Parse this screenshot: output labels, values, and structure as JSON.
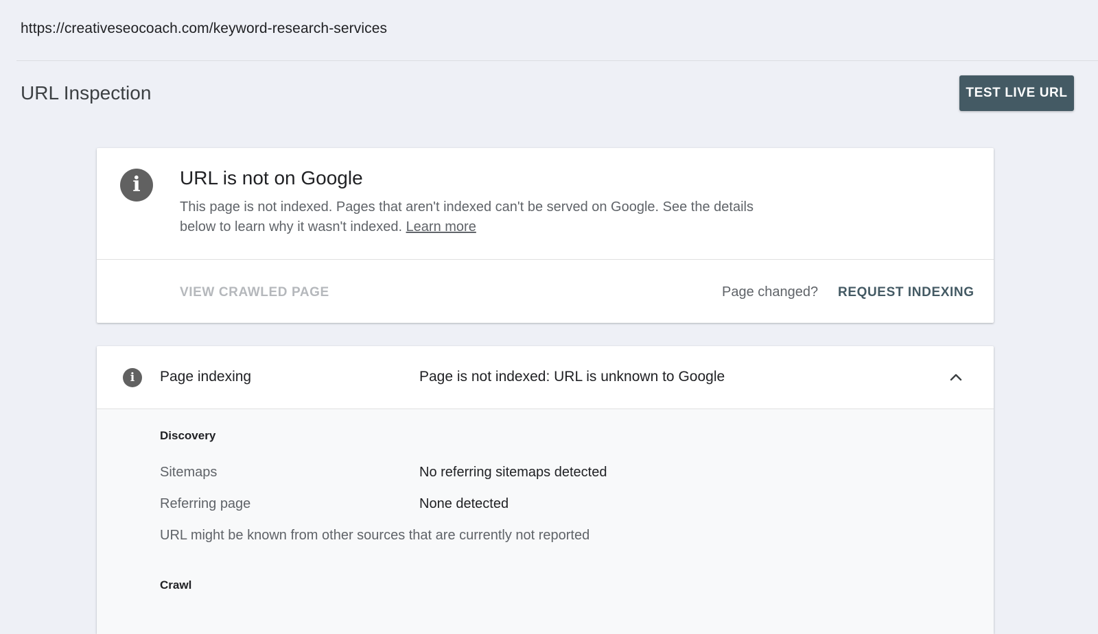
{
  "url_bar": {
    "url": "https://creativeseocoach.com/keyword-research-services"
  },
  "header": {
    "title": "URL Inspection",
    "test_live_url_label": "TEST LIVE URL"
  },
  "status_card": {
    "title": "URL is not on Google",
    "description": "This page is not indexed. Pages that aren't indexed can't be served on Google. See the details below to learn why it wasn't indexed.",
    "learn_more_label": "Learn more",
    "view_crawled_label": "VIEW CRAWLED PAGE",
    "page_changed_label": "Page changed?",
    "request_indexing_label": "REQUEST INDEXING"
  },
  "indexing_card": {
    "label": "Page indexing",
    "status": "Page is not indexed: URL is unknown to Google",
    "discovery": {
      "heading": "Discovery",
      "rows": [
        {
          "label": "Sitemaps",
          "value": "No referring sitemaps detected"
        },
        {
          "label": "Referring page",
          "value": "None detected"
        }
      ],
      "note": "URL might be known from other sources that are currently not reported"
    },
    "crawl": {
      "heading": "Crawl"
    }
  },
  "colors": {
    "background": "#eef0f6",
    "button_bg": "#445a64",
    "icon_gray": "#616161",
    "muted_text": "#5f6368",
    "disabled_text": "#b5b8bc"
  },
  "icons": {
    "status_icon": "info-icon",
    "section_icon": "info-icon",
    "expand_toggle": "chevron-up-icon"
  }
}
